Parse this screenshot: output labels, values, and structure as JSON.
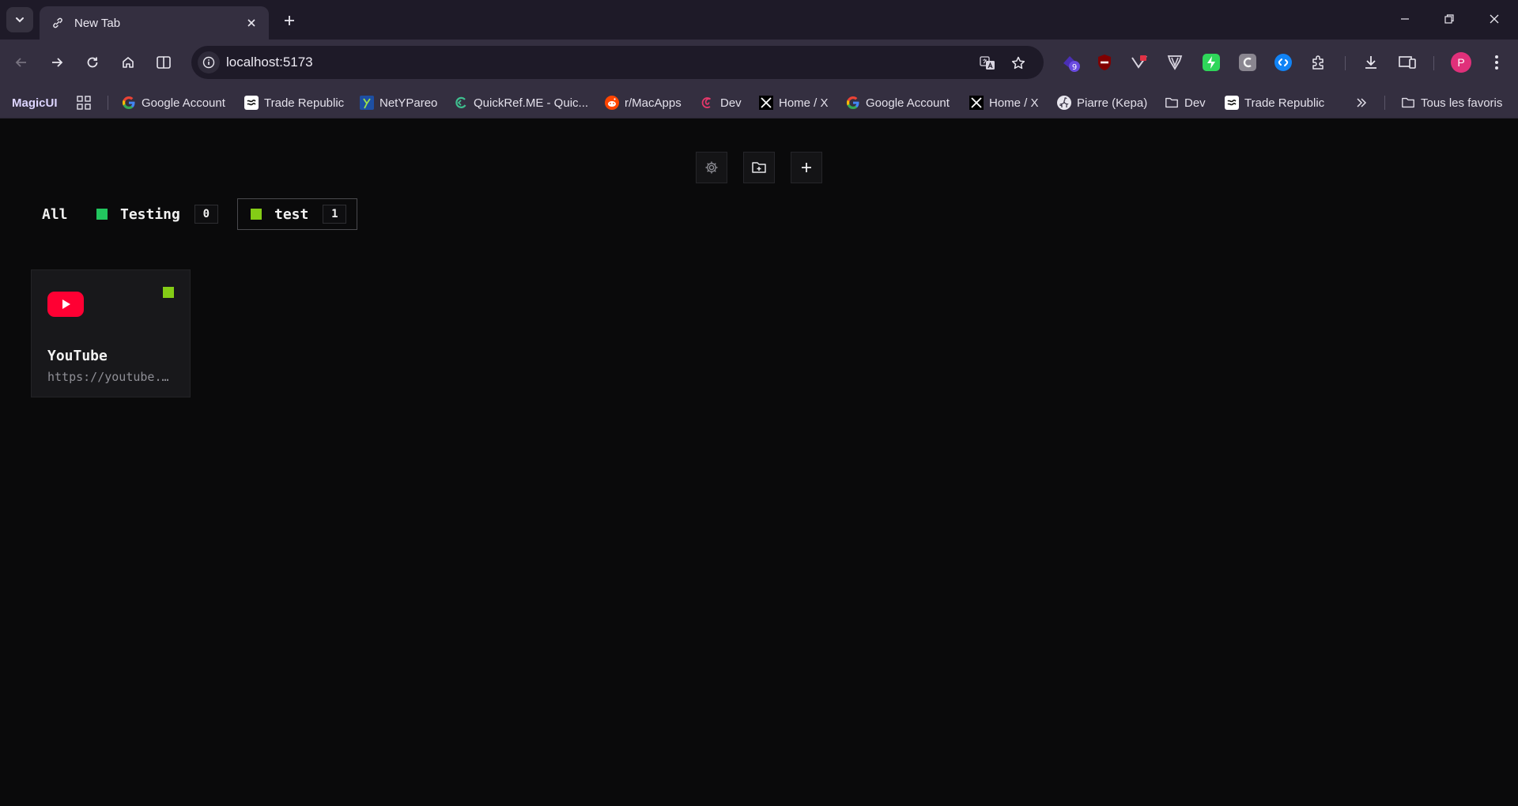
{
  "browser": {
    "tab": {
      "title": "New Tab"
    },
    "address_bar": {
      "url": "localhost:5173"
    },
    "extensions": {
      "badge_count": "9"
    },
    "profile": {
      "initial": "P"
    },
    "colors": {
      "frame": "#1e1a28",
      "toolbar": "#342f40",
      "avatar": "#e0307a"
    }
  },
  "bookmarks": {
    "items": [
      {
        "label": "MagicUI",
        "icon": "none"
      },
      {
        "label": "Google Account",
        "icon": "google-icon"
      },
      {
        "label": "Trade Republic",
        "icon": "trade-republic-icon"
      },
      {
        "label": "NetYPareo",
        "icon": "netypareo-icon"
      },
      {
        "label": "QuickRef.ME - Quic...",
        "icon": "quickref-icon"
      },
      {
        "label": "r/MacApps",
        "icon": "reddit-icon"
      },
      {
        "label": "Dev",
        "icon": "debian-swirl-icon"
      },
      {
        "label": "Home / X",
        "icon": "x-icon"
      },
      {
        "label": "Google Account",
        "icon": "google-icon"
      },
      {
        "label": "Home / X",
        "icon": "x-icon"
      },
      {
        "label": "Piarre (Kepa)",
        "icon": "github-icon"
      },
      {
        "label": "Dev",
        "icon": "folder-icon"
      },
      {
        "label": "Trade Republic",
        "icon": "trade-republic-icon"
      }
    ],
    "all_bookmarks": "Tous les favoris"
  },
  "filters": {
    "all": "All",
    "groups": [
      {
        "label": "Testing",
        "count": "0",
        "color": "#22c55e"
      },
      {
        "label": "test",
        "count": "1",
        "color": "#84cc16",
        "active": true
      }
    ]
  },
  "cards": [
    {
      "title": "YouTube",
      "url": "https://youtube.com",
      "group_color": "#84cc16",
      "icon": "youtube-icon"
    }
  ]
}
